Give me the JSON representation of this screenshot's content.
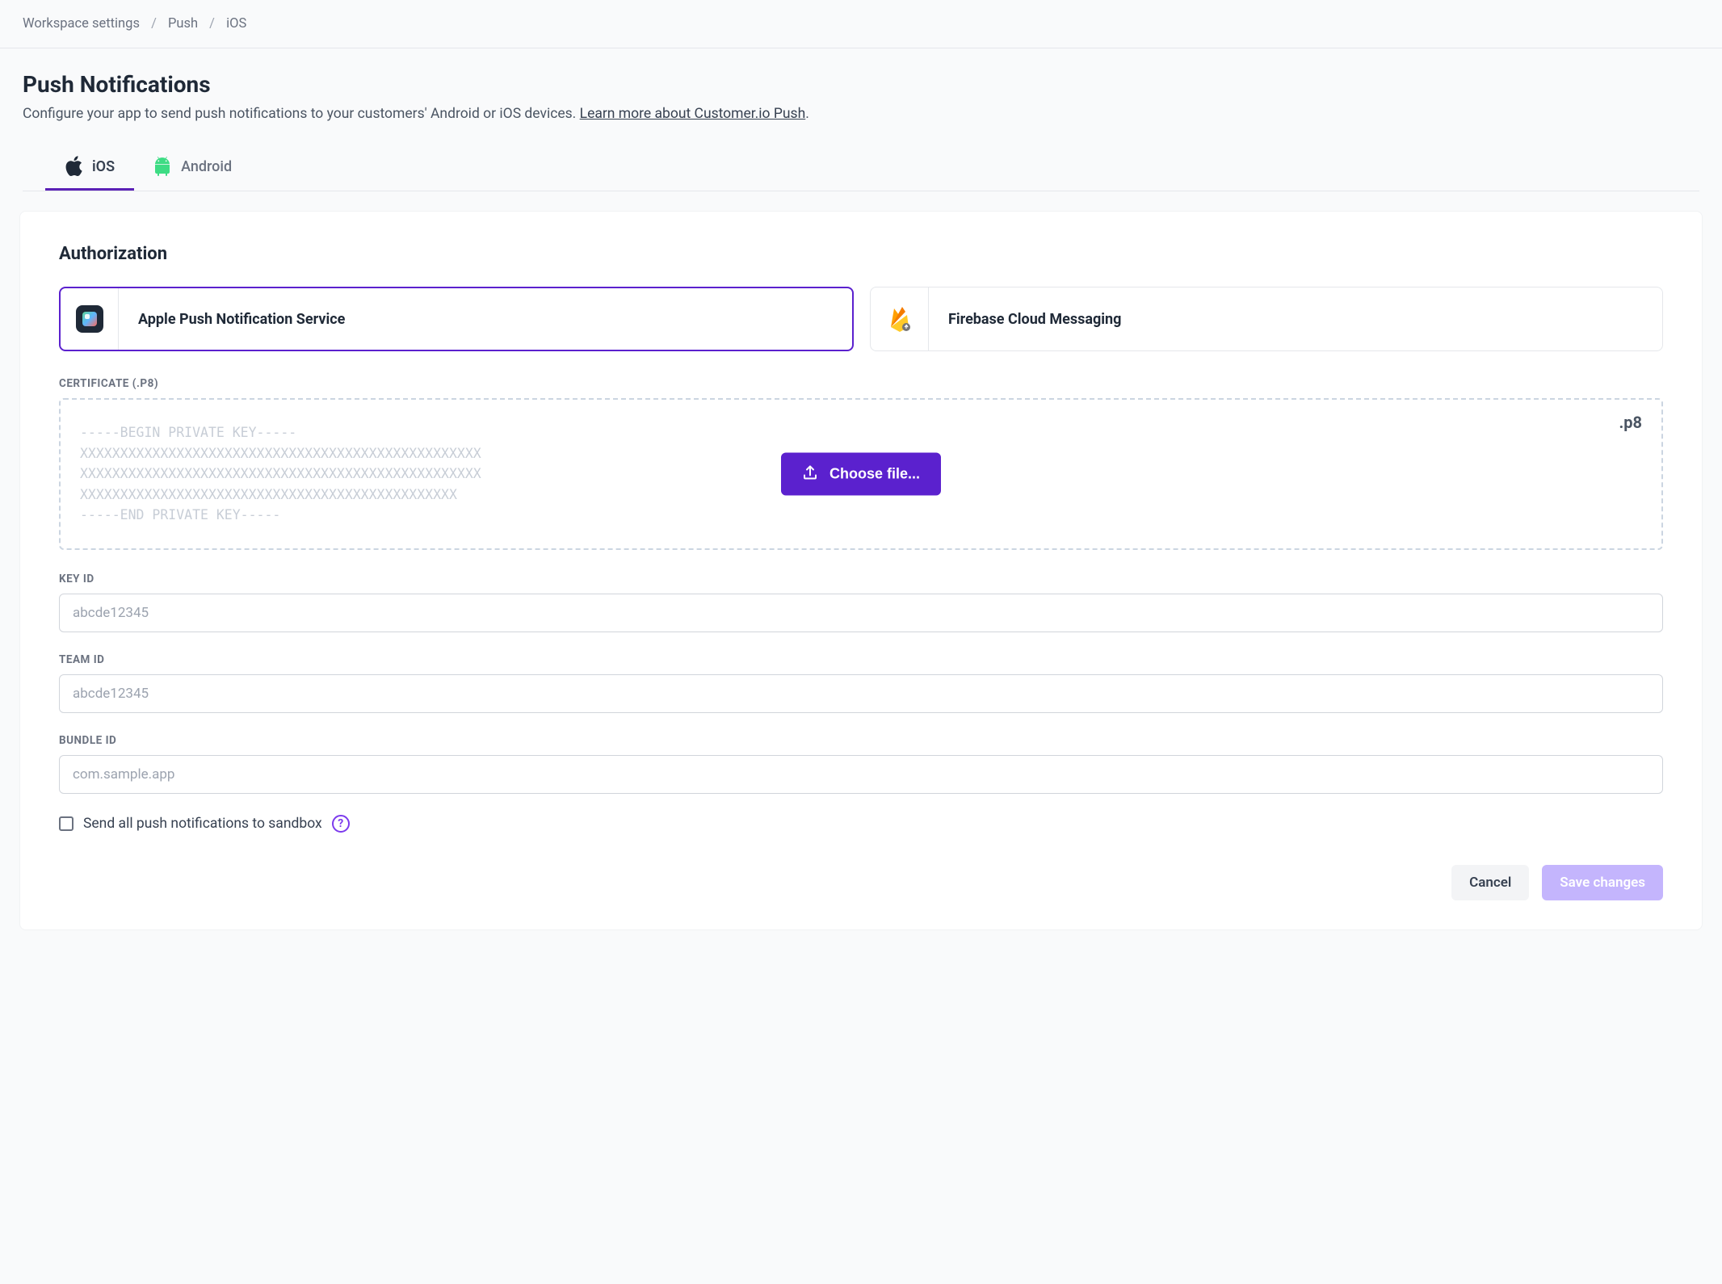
{
  "breadcrumb": {
    "root": "Workspace settings",
    "mid": "Push",
    "current": "iOS"
  },
  "header": {
    "title": "Push Notifications",
    "desc_prefix": "Configure your app to send push notifications to your customers' Android or iOS devices. ",
    "learn_more": "Learn more about Customer.io Push",
    "desc_suffix": "."
  },
  "tabs": {
    "ios": "iOS",
    "android": "Android"
  },
  "authorization": {
    "title": "Authorization",
    "providers": {
      "apns": "Apple Push Notification Service",
      "fcm": "Firebase Cloud Messaging"
    }
  },
  "certificate": {
    "label": "CERTIFICATE (.P8)",
    "ext": ".p8",
    "placeholder_key": "-----BEGIN PRIVATE KEY-----\nXXXXXXXXXXXXXXXXXXXXXXXXXXXXXXXXXXXXXXXXXXXXXXXXXX\nXXXXXXXXXXXXXXXXXXXXXXXXXXXXXXXXXXXXXXXXXXXXXXXXXX\nXXXXXXXXXXXXXXXXXXXXXXXXXXXXXXXXXXXXXXXXXXXXXXX\n-----END PRIVATE KEY-----",
    "choose_file": "Choose file..."
  },
  "fields": {
    "key_id": {
      "label": "KEY ID",
      "placeholder": "abcde12345"
    },
    "team_id": {
      "label": "TEAM ID",
      "placeholder": "abcde12345"
    },
    "bundle_id": {
      "label": "BUNDLE ID",
      "placeholder": "com.sample.app"
    }
  },
  "sandbox": {
    "label": "Send all push notifications to sandbox"
  },
  "buttons": {
    "cancel": "Cancel",
    "save": "Save changes"
  }
}
